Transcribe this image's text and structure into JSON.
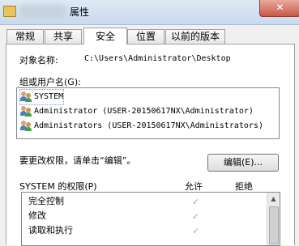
{
  "window": {
    "title": "属性",
    "close_glyph": "✕"
  },
  "tabs": [
    "常规",
    "共享",
    "安全",
    "位置",
    "以前的版本"
  ],
  "object_name": {
    "label": "对象名称:",
    "value": "C:\\Users\\Administrator\\Desktop"
  },
  "groups": {
    "label": "组或用户名(G):",
    "items": [
      "SYSTEM",
      "Administrator (USER-20150617NX\\Administrator)",
      "Administrators (USER-20150617NX\\Administrators)"
    ]
  },
  "change_hint": "要更改权限，请单击“编辑”。",
  "edit_button": "编辑(E)...",
  "permissions": {
    "header": "SYSTEM 的权限(P)",
    "allow_label": "允许",
    "deny_label": "拒绝",
    "rows": [
      {
        "name": "完全控制",
        "allow": true
      },
      {
        "name": "修改",
        "allow": true
      },
      {
        "name": "读取和执行",
        "allow": true
      }
    ]
  }
}
